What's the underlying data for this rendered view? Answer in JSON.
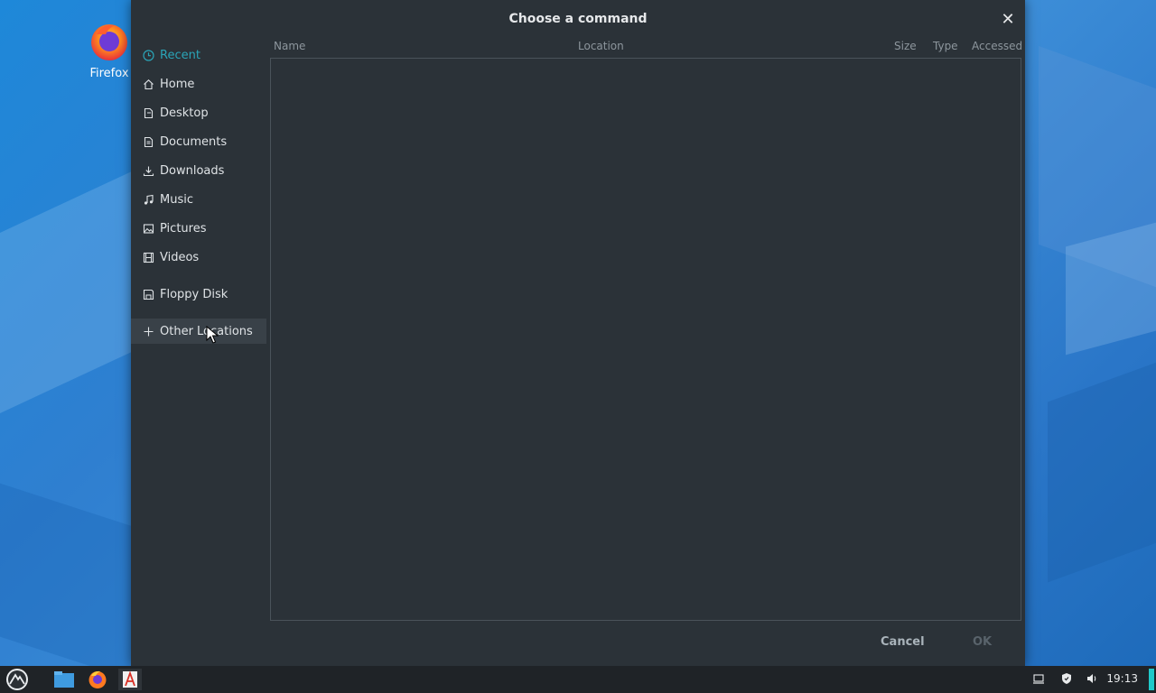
{
  "desktop": {
    "icon_label": "Firefox"
  },
  "dialog": {
    "title": "Choose a command",
    "close_icon": "close-icon",
    "sidebar": {
      "items": [
        {
          "label": "Recent",
          "icon": "clock-icon"
        },
        {
          "label": "Home",
          "icon": "home-icon"
        },
        {
          "label": "Desktop",
          "icon": "desktop-icon"
        },
        {
          "label": "Documents",
          "icon": "documents-icon"
        },
        {
          "label": "Downloads",
          "icon": "download-icon"
        },
        {
          "label": "Music",
          "icon": "music-icon"
        },
        {
          "label": "Pictures",
          "icon": "pictures-icon"
        },
        {
          "label": "Videos",
          "icon": "videos-icon"
        },
        {
          "label": "Floppy Disk",
          "icon": "floppy-icon"
        },
        {
          "label": "Other Locations",
          "icon": "plus-icon"
        }
      ]
    },
    "columns": [
      "Name",
      "Location",
      "Size",
      "Type",
      "Accessed"
    ],
    "buttons": {
      "cancel": "Cancel",
      "ok": "OK"
    }
  },
  "taskbar": {
    "clock": "19:13"
  },
  "colors": {
    "accent": "#2aa5b8",
    "dialog_bg": "#2b3238",
    "taskbar_bg": "#1f2327",
    "tray_accent": "#20c9c9"
  }
}
